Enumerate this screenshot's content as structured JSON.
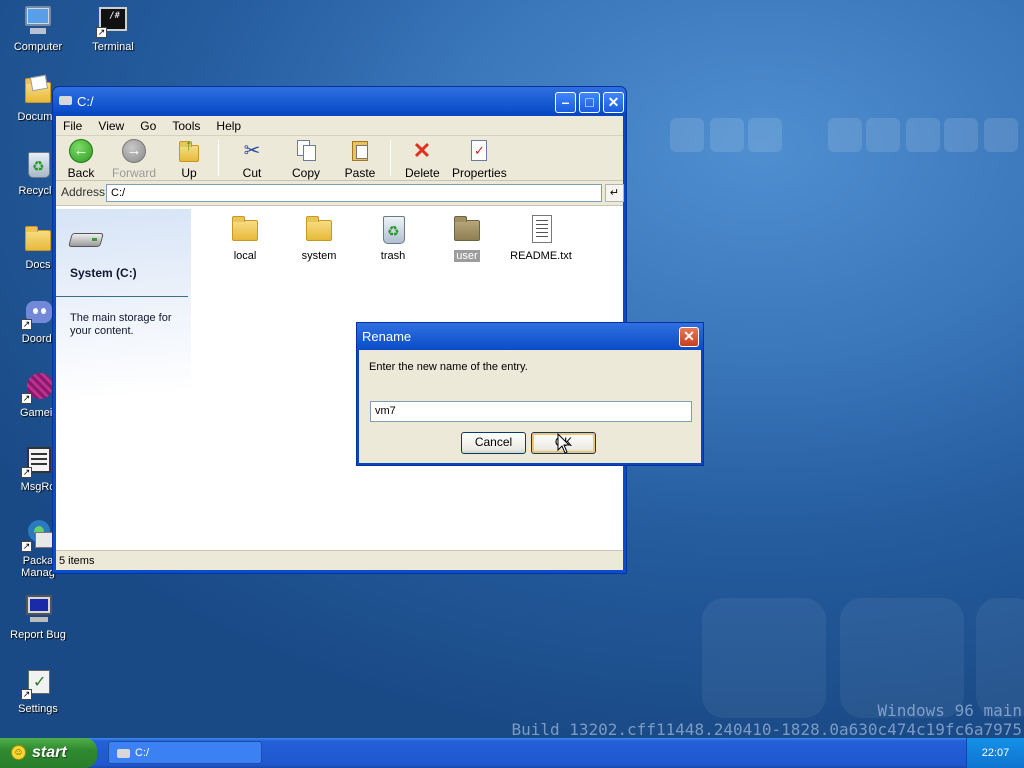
{
  "desktop": {
    "icons": [
      {
        "label": "Computer",
        "icon": "computer-icon"
      },
      {
        "label": "Terminal",
        "icon": "terminal-icon"
      },
      {
        "label": "Docume",
        "icon": "documents-icon"
      },
      {
        "label": "Recycle",
        "icon": "recycle-bin-icon"
      },
      {
        "label": "Docs",
        "icon": "folder-icon"
      },
      {
        "label": "Doordi",
        "icon": "discord-icon"
      },
      {
        "label": "Gameir",
        "icon": "game-icon"
      },
      {
        "label": "MsgRo",
        "icon": "message-room-icon"
      },
      {
        "label": "Packa Manag",
        "icon": "package-manager-icon"
      },
      {
        "label": "Report Bug",
        "icon": "report-bug-icon"
      },
      {
        "label": "Settings",
        "icon": "settings-icon"
      }
    ],
    "terminal_glyph": "/#",
    "watermark_line1": "Windows 96 main",
    "watermark_line2": "Build 13202.cff11448.240410-1828.0a630c474c19fc6a7975"
  },
  "explorer": {
    "title": "C:/",
    "menu": [
      "File",
      "View",
      "Go",
      "Tools",
      "Help"
    ],
    "toolbar": {
      "back": "Back",
      "forward": "Forward",
      "up": "Up",
      "cut": "Cut",
      "copy": "Copy",
      "paste": "Paste",
      "delete": "Delete",
      "properties": "Properties"
    },
    "address_label": "Address",
    "address_value": "C:/",
    "go_glyph": "↵",
    "side_title": "System (C:)",
    "side_desc": "The main storage for your content.",
    "items": [
      "local",
      "system",
      "trash",
      "user",
      "README.txt"
    ],
    "selected_item": "user",
    "status": "5 items"
  },
  "dialog": {
    "title": "Rename",
    "message": "Enter the new name of the entry.",
    "input_value": "vm7",
    "cancel": "Cancel",
    "ok": "OK"
  },
  "taskbar": {
    "start": "start",
    "task": "C:/",
    "clock": "22:07"
  }
}
